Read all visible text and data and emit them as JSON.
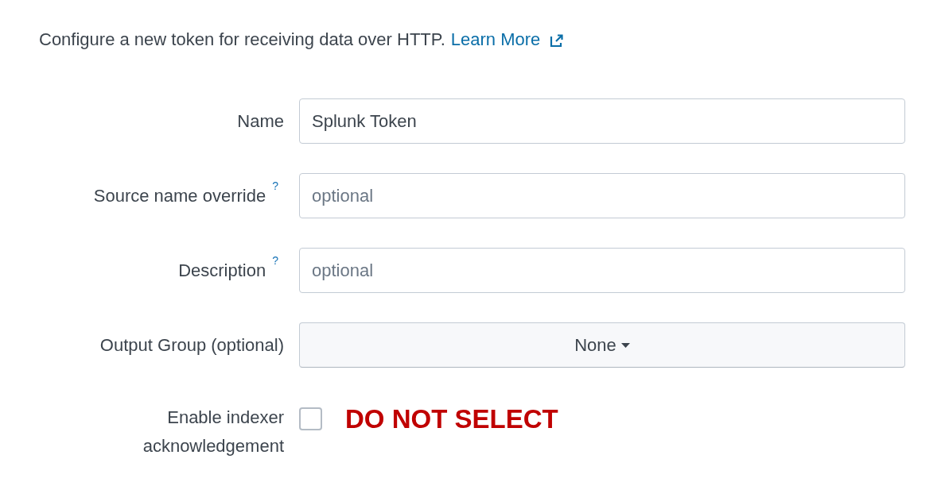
{
  "intro": {
    "text": "Configure a new token for receiving data over HTTP.",
    "link": "Learn More"
  },
  "fields": [
    {
      "kind": "text",
      "label": "Name",
      "value": "Splunk Token"
    },
    {
      "kind": "text",
      "label": "Source name override",
      "help": "?",
      "placeholder": "optional"
    },
    {
      "kind": "text",
      "label": "Description",
      "help": "?",
      "placeholder": "optional"
    },
    {
      "kind": "dropdown",
      "label": "Output Group (optional)",
      "value": "None"
    },
    {
      "kind": "checkbox",
      "label": "Enable indexer acknowledgement",
      "checked": false,
      "note": "DO NOT SELECT"
    }
  ]
}
